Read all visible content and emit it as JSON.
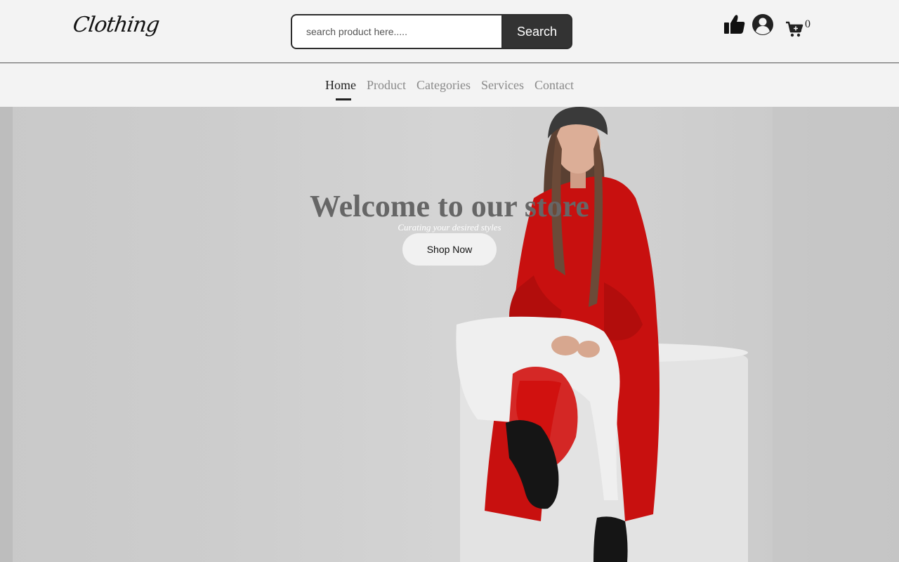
{
  "brand": {
    "logo_text": "Clothing"
  },
  "search": {
    "placeholder": "search product here.....",
    "button_label": "Search"
  },
  "header_icons": {
    "like": "thumbs-up-icon",
    "account": "user-circle-icon",
    "cart": "cart-plus-icon",
    "cart_count": "0"
  },
  "nav": {
    "items": [
      {
        "label": "Home",
        "active": true
      },
      {
        "label": "Product"
      },
      {
        "label": "Categories"
      },
      {
        "label": "Services"
      },
      {
        "label": "Contact"
      }
    ]
  },
  "hero": {
    "title": "Welcome to our store",
    "subtitle": "Curating your desired styles",
    "cta_label": "Shop Now"
  },
  "colors": {
    "dark": "#333333",
    "coat_red": "#c8100f",
    "background": "#f3f3f3"
  }
}
